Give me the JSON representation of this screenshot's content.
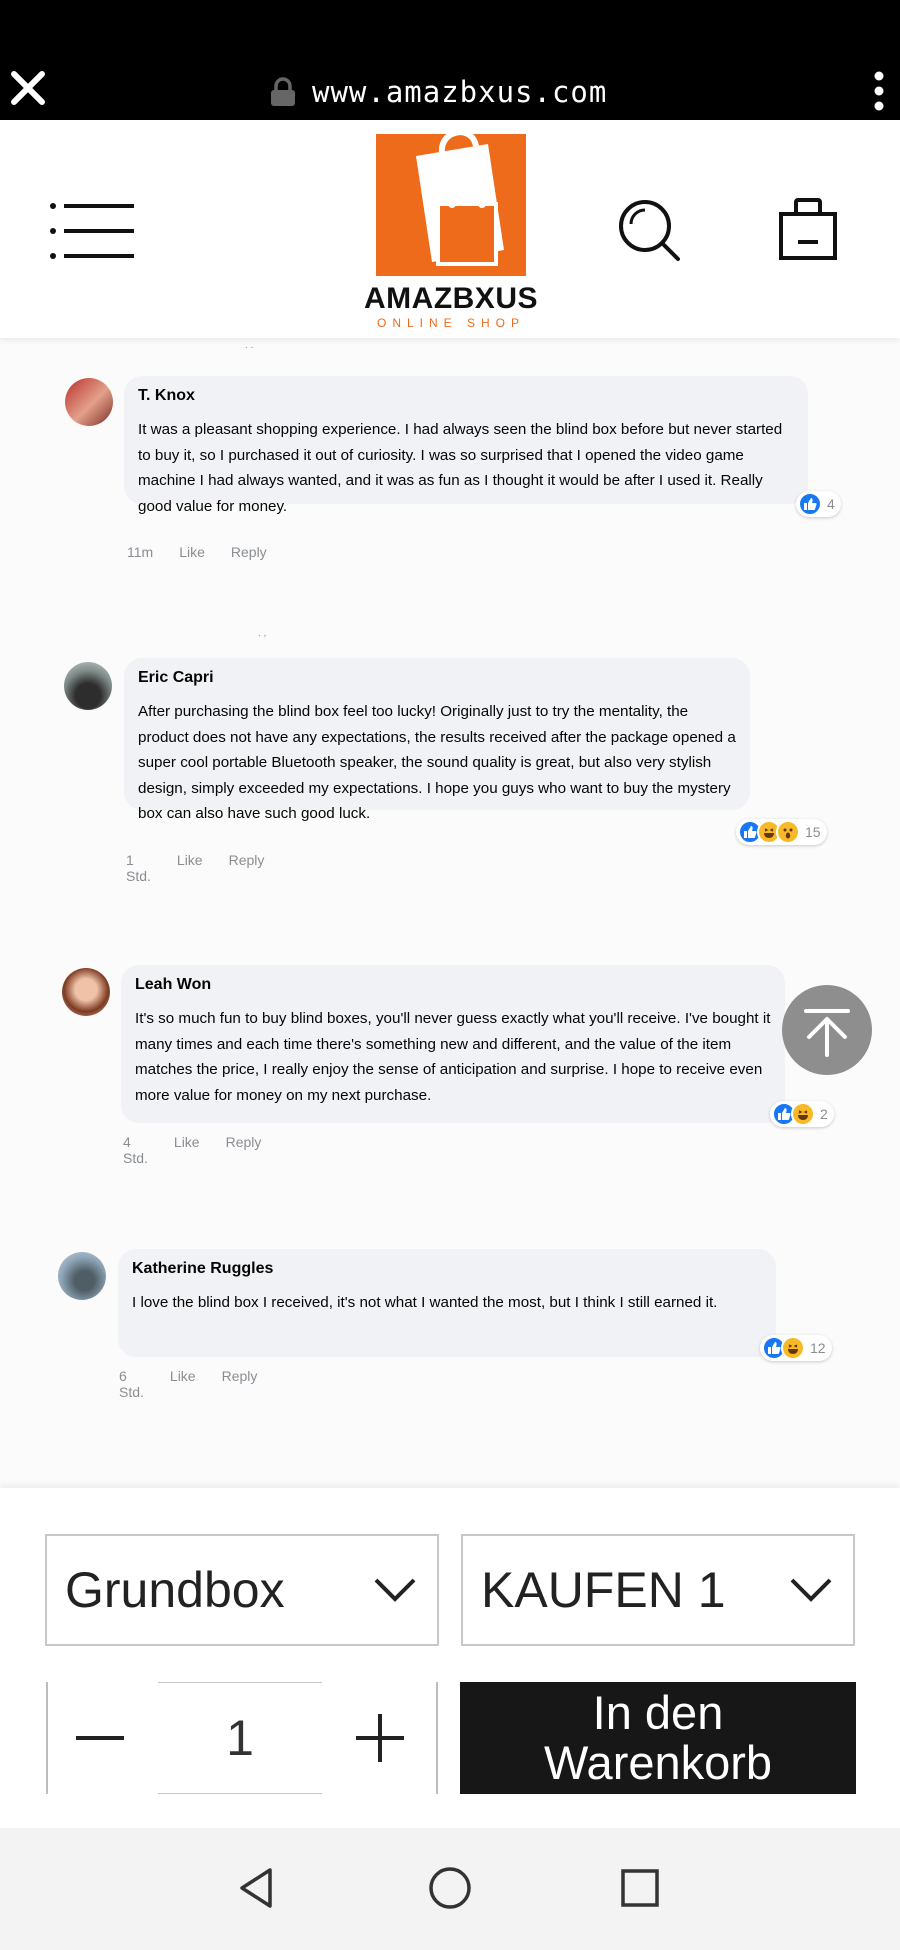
{
  "browser": {
    "url": "www.amazbxus.com"
  },
  "shop": {
    "logo_name": "AMAZBXUS",
    "logo_sub": "ONLINE SHOP",
    "accent": "#ee6b1b"
  },
  "comments": [
    {
      "author": "T. Knox",
      "text": "It was a pleasant shopping experience. I had always seen the blind box before but never started to buy it, so I purchased it out of curiosity. I was so surprised that I opened the video game machine I had always wanted, and it was as fun as I thought it would be after I used it. Really good value for money.",
      "time": "11m",
      "like": "Like",
      "reply": "Reply",
      "reactions": [
        "like-icon"
      ],
      "reaction_count": "4"
    },
    {
      "author": "Eric Capri",
      "text": "After purchasing the blind box feel too lucky! Originally just to try the mentality, the product does not have any expectations, the results received after the package opened a super cool portable Bluetooth speaker, the sound quality is great, but also very stylish design, simply exceeded my expectations. I hope you guys who want to buy the mystery box can also have such good luck.",
      "time": "1 Std.",
      "like": "Like",
      "reply": "Reply",
      "reactions": [
        "like-icon",
        "haha-icon",
        "wow-icon"
      ],
      "reaction_count": "15"
    },
    {
      "author": "Leah Won",
      "text": "It's so much fun to buy blind boxes, you'll never guess exactly what you'll receive. I've bought it many times and each time there's something new and different, and the value of the item matches the price, I really enjoy the sense of anticipation and surprise. I hope to receive even more value for money on my next purchase.",
      "time": "4 Std.",
      "like": "Like",
      "reply": "Reply",
      "reactions": [
        "like-icon",
        "haha-icon"
      ],
      "reaction_count": "2"
    },
    {
      "author": "Katherine Ruggles",
      "text": "I love the blind box I received, it's not what I wanted the most, but I think I still earned it.",
      "time": "6 Std.",
      "like": "Like",
      "reply": "Reply",
      "reactions": [
        "like-icon",
        "haha-icon"
      ],
      "reaction_count": "12"
    }
  ],
  "purchase": {
    "variant": "Grundbox",
    "quantity_option": "KAUFEN 1",
    "quantity": "1",
    "add_to_cart": "In den Warenkorb"
  }
}
